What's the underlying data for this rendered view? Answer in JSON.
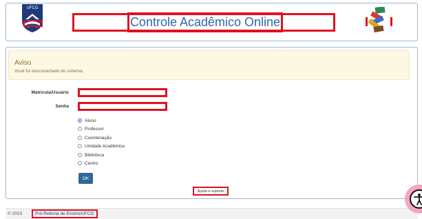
{
  "header": {
    "title": "Controle Acadêmico Online",
    "logo_text": "UFCG"
  },
  "alert": {
    "title": "Aviso",
    "message": "Você foi desconectado do sistema."
  },
  "form": {
    "username_label": "Matrícula/Usuário",
    "username_value": "",
    "password_label": "Senha",
    "password_value": "",
    "roles": [
      {
        "label": "Aluno",
        "checked": true
      },
      {
        "label": "Professor",
        "checked": false
      },
      {
        "label": "Coordenação",
        "checked": false
      },
      {
        "label": "Unidade Acadêmica",
        "checked": false
      },
      {
        "label": "Biblioteca",
        "checked": false
      },
      {
        "label": "Centro",
        "checked": false
      }
    ],
    "submit_label": "OK",
    "help_link": "Ajuda e suporte"
  },
  "footer": {
    "copyright": "© 2023",
    "link_label": "Pró-Reitoria de Ensino/UFCG"
  },
  "colors": {
    "accent": "#336699",
    "title": "#2f68a8",
    "alert_bg": "#fcf8e3",
    "annotation_red": "#e01020"
  },
  "icons": {
    "logo": "ufcg-logo-icon",
    "books": "books-icon",
    "accessibility": "accessibility-icon"
  }
}
